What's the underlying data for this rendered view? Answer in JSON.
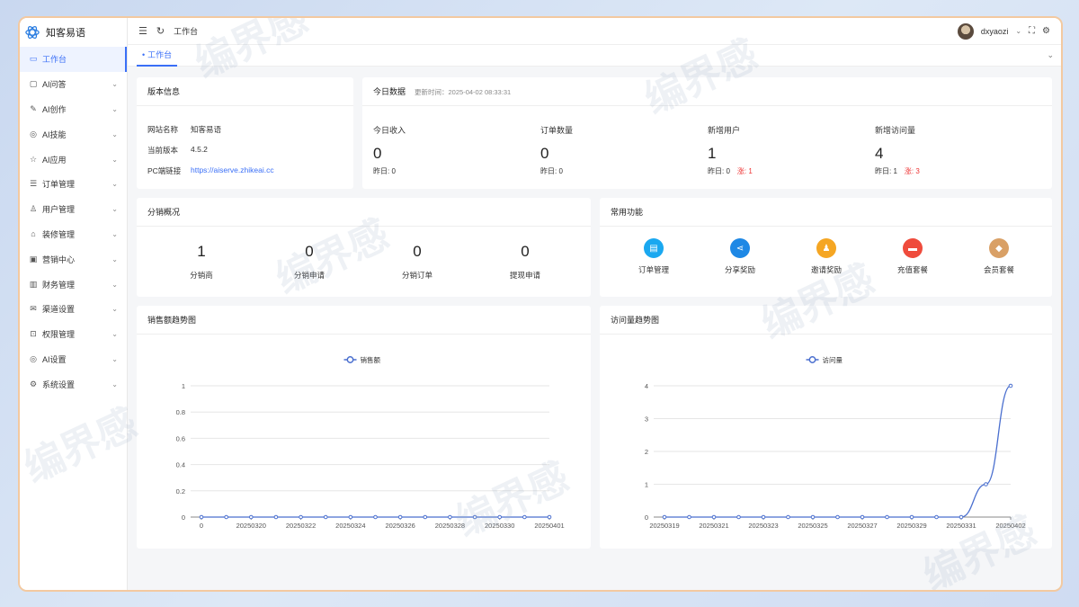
{
  "app": {
    "name": "知客易语"
  },
  "sidebar": {
    "items": [
      {
        "label": "工作台",
        "icon": "monitor-icon",
        "glyph": "▭",
        "active": true,
        "expandable": false
      },
      {
        "label": "AI问答",
        "icon": "chat-icon",
        "glyph": "▢",
        "expandable": true
      },
      {
        "label": "AI创作",
        "icon": "pen-icon",
        "glyph": "✎",
        "expandable": true
      },
      {
        "label": "AI技能",
        "icon": "target-icon",
        "glyph": "◎",
        "expandable": true
      },
      {
        "label": "AI应用",
        "icon": "star-icon",
        "glyph": "☆",
        "expandable": true
      },
      {
        "label": "订单管理",
        "icon": "list-icon",
        "glyph": "☰",
        "expandable": true
      },
      {
        "label": "用户管理",
        "icon": "user-icon",
        "glyph": "♙",
        "expandable": true
      },
      {
        "label": "装修管理",
        "icon": "shop-icon",
        "glyph": "⌂",
        "expandable": true
      },
      {
        "label": "营销中心",
        "icon": "briefcase-icon",
        "glyph": "▣",
        "expandable": true
      },
      {
        "label": "财务管理",
        "icon": "chart-icon",
        "glyph": "▥",
        "expandable": true
      },
      {
        "label": "渠道设置",
        "icon": "mail-icon",
        "glyph": "✉",
        "expandable": true
      },
      {
        "label": "权限管理",
        "icon": "lock-icon",
        "glyph": "⊡",
        "expandable": true
      },
      {
        "label": "AI设置",
        "icon": "target-icon",
        "glyph": "◎",
        "expandable": true
      },
      {
        "label": "系统设置",
        "icon": "gear-icon",
        "glyph": "⚙",
        "expandable": true
      }
    ]
  },
  "header": {
    "breadcrumb": "工作台",
    "username": "dxyaozi"
  },
  "tabs": [
    {
      "label": "工作台"
    }
  ],
  "version_card": {
    "title": "版本信息",
    "rows": [
      {
        "key": "网站名称",
        "value": "知客易语"
      },
      {
        "key": "当前版本",
        "value": "4.5.2"
      },
      {
        "key": "PC端链接",
        "value": "https://aiserve.zhikeai.cc"
      }
    ]
  },
  "today_card": {
    "title": "今日数据",
    "updated": "更新时间：2025-04-02 08:33:31",
    "stats": [
      {
        "label": "今日收入",
        "value": "0",
        "yesterday": "昨日: 0",
        "rise": ""
      },
      {
        "label": "订单数量",
        "value": "0",
        "yesterday": "昨日: 0",
        "rise": ""
      },
      {
        "label": "新增用户",
        "value": "1",
        "yesterday": "昨日: 0",
        "rise": "涨: 1"
      },
      {
        "label": "新增访问量",
        "value": "4",
        "yesterday": "昨日: 1",
        "rise": "涨: 3"
      }
    ]
  },
  "distribution_card": {
    "title": "分销概况",
    "items": [
      {
        "label": "分销商",
        "value": "1"
      },
      {
        "label": "分销申请",
        "value": "0"
      },
      {
        "label": "分销订单",
        "value": "0"
      },
      {
        "label": "提现申请",
        "value": "0"
      }
    ]
  },
  "functions_card": {
    "title": "常用功能",
    "items": [
      {
        "label": "订单管理",
        "icon": "clipboard-icon",
        "color": "#1aa8f0",
        "glyph": "▤"
      },
      {
        "label": "分享奖励",
        "icon": "share-icon",
        "color": "#1e88e5",
        "glyph": "⋖"
      },
      {
        "label": "邀请奖励",
        "icon": "invite-icon",
        "color": "#f5a623",
        "glyph": "♟"
      },
      {
        "label": "充值套餐",
        "icon": "card-icon",
        "color": "#ef4b3c",
        "glyph": "▬"
      },
      {
        "label": "会员套餐",
        "icon": "diamond-icon",
        "color": "#d9a066",
        "glyph": "◆"
      }
    ]
  },
  "sales_chart": {
    "title": "销售额趋势图",
    "chart_data": {
      "type": "line",
      "series": [
        {
          "name": "销售额",
          "values": [
            0,
            0,
            0,
            0,
            0,
            0,
            0,
            0,
            0,
            0,
            0,
            0,
            0,
            0,
            0
          ]
        }
      ],
      "x": [
        "0",
        "20250319",
        "20250320",
        "20250321",
        "20250322",
        "20250323",
        "20250324",
        "20250325",
        "20250326",
        "20250327",
        "20250328",
        "20250329",
        "20250330",
        "20250331",
        "20250401"
      ],
      "xticks": [
        "0",
        "20250320",
        "20250322",
        "20250324",
        "20250326",
        "20250328",
        "20250330",
        "20250401"
      ],
      "yticks": [
        "0",
        "0.2",
        "0.4",
        "0.6",
        "0.8",
        "1"
      ],
      "ylim": [
        0,
        1
      ],
      "grid": true,
      "legend": "top-center"
    }
  },
  "visits_chart": {
    "title": "访问量趋势图",
    "chart_data": {
      "type": "line",
      "series": [
        {
          "name": "访问量",
          "values": [
            0,
            0,
            0,
            0,
            0,
            0,
            0,
            0,
            0,
            0,
            0,
            0,
            0,
            1,
            4
          ]
        }
      ],
      "x": [
        "20250319",
        "20250320",
        "20250321",
        "20250322",
        "20250323",
        "20250324",
        "20250325",
        "20250326",
        "20250327",
        "20250328",
        "20250329",
        "20250330",
        "20250331",
        "20250401",
        "20250402"
      ],
      "xticks": [
        "20250319",
        "20250321",
        "20250323",
        "20250325",
        "20250327",
        "20250329",
        "20250331",
        "20250402"
      ],
      "yticks": [
        "0",
        "1",
        "2",
        "3",
        "4"
      ],
      "ylim": [
        0,
        4
      ],
      "grid": true,
      "legend": "top-center"
    }
  },
  "colors": {
    "accent": "#3a6ff7",
    "line": "#4a6fcf",
    "rise": "#ee3333"
  },
  "watermark": "编界感"
}
